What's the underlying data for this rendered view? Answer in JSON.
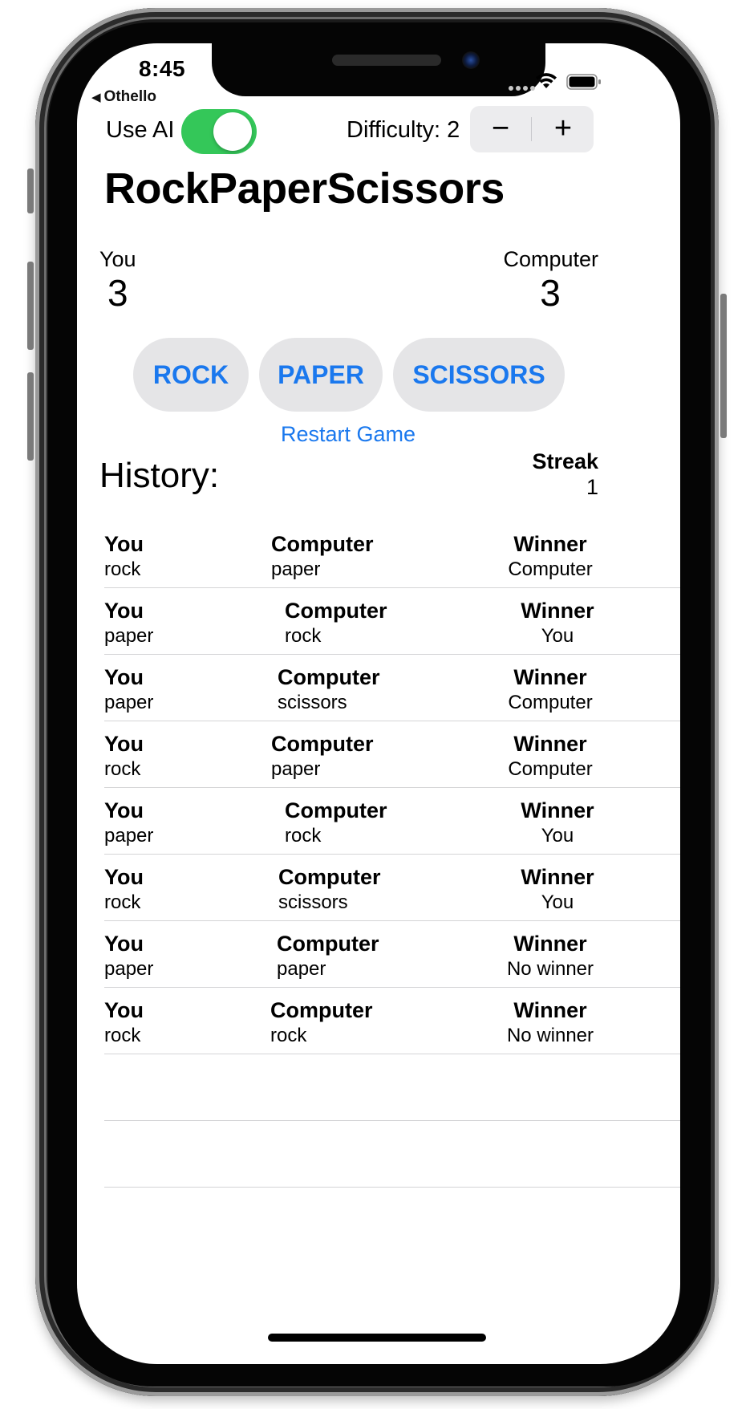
{
  "status_bar": {
    "time": "8:45",
    "back_app": "Othello"
  },
  "controls": {
    "use_ai_label": "Use AI",
    "use_ai_enabled": true,
    "toggle_color": "#34c759",
    "difficulty_label": "Difficulty: 2",
    "stepper_minus": "−",
    "stepper_plus": "+"
  },
  "title": "RockPaperScissors",
  "score": {
    "you_label": "You",
    "you_value": "3",
    "computer_label": "Computer",
    "computer_value": "3"
  },
  "choices": {
    "rock": "ROCK",
    "paper": "PAPER",
    "scissors": "SCISSORS",
    "accent_color": "#1a78ee"
  },
  "restart_label": "Restart Game",
  "history": {
    "title": "History:",
    "streak_label": "Streak",
    "streak_value": "1",
    "col_you": "You",
    "col_computer": "Computer",
    "col_winner": "Winner",
    "rows": [
      {
        "you": "rock",
        "computer": "paper",
        "winner": "Computer"
      },
      {
        "you": "paper",
        "computer": "rock",
        "winner": "You"
      },
      {
        "you": "paper",
        "computer": "scissors",
        "winner": "Computer"
      },
      {
        "you": "rock",
        "computer": "paper",
        "winner": "Computer"
      },
      {
        "you": "paper",
        "computer": "rock",
        "winner": "You"
      },
      {
        "you": "rock",
        "computer": "scissors",
        "winner": "You"
      },
      {
        "you": "paper",
        "computer": "paper",
        "winner": "No winner"
      },
      {
        "you": "rock",
        "computer": "rock",
        "winner": "No winner"
      }
    ]
  }
}
